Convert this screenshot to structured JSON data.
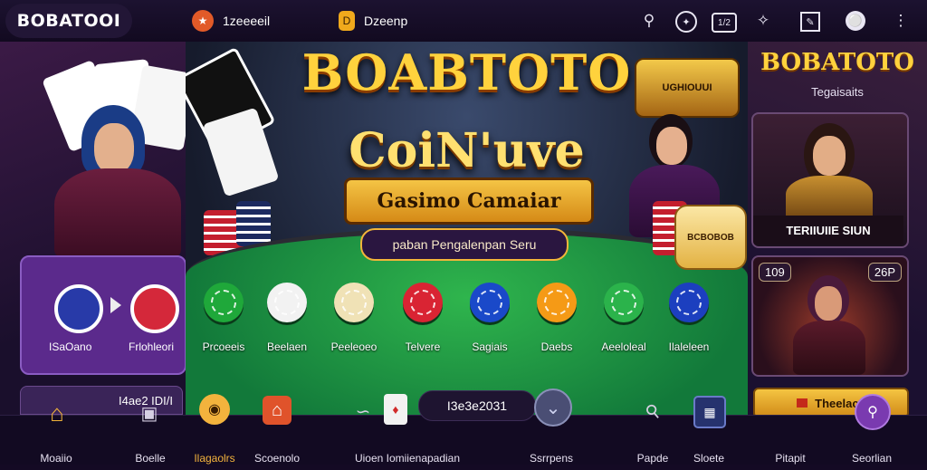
{
  "header": {
    "logo": "BOBATOOI",
    "item1": "1zeeeeil",
    "item2": "Dzeenp",
    "icons": [
      "search-icon",
      "compass-icon",
      "ticket-icon",
      "sparkle-icon",
      "edit-icon",
      "globe-icon",
      "more-icon"
    ],
    "ticket_label": "1/2"
  },
  "hero": {
    "title": "BOABTOTO",
    "coin_title": "CoiN'uve",
    "banner": "Gasimo Camaiar",
    "subtitle": "paban Pengalenpan Seru",
    "emblem": "UGHIOUUI"
  },
  "chips": [
    {
      "label": "Prcoeeis",
      "color": "#1fa83a"
    },
    {
      "label": "Beelaen",
      "color": "#f2f2f2"
    },
    {
      "label": "Peeleoeo",
      "color": "#f0e2b6"
    },
    {
      "label": "Telvere",
      "color": "#d92433"
    },
    {
      "label": "Sagiais",
      "color": "#1a49c9"
    },
    {
      "label": "Daebs",
      "color": "#f59a16"
    },
    {
      "label": "Aeeloleal",
      "color": "#2bb34b"
    },
    {
      "label": "Ilaleleen",
      "color": "#1c3fbf"
    }
  ],
  "left_panel": {
    "label1": "ISaOano",
    "label2": "Frlohleori",
    "footer": "I4ae2 IDI/I"
  },
  "right_panel": {
    "title": "BOBATOTO",
    "subtitle": "Tegaisaits",
    "card1_label": "TERIIUIIE SIUN",
    "badge_left": "109",
    "badge_right": "26P",
    "button": "Theelacc"
  },
  "coin_stack_label": "BCBOBOB",
  "bottom_nav": {
    "items": [
      "Moaiio",
      "Boelle",
      "Ilagaolrs",
      "Scoenolo",
      "Uioen Iomiienapadian",
      "Ssrrpens",
      "Papde",
      "Sloete",
      "Pitapit",
      "Seorlian"
    ],
    "center_readout": "I3e3e2031"
  },
  "colors": {
    "accent_gold": "#ffd23d",
    "felt_green": "#1f9a43",
    "active_nav": "#f3b33d"
  }
}
